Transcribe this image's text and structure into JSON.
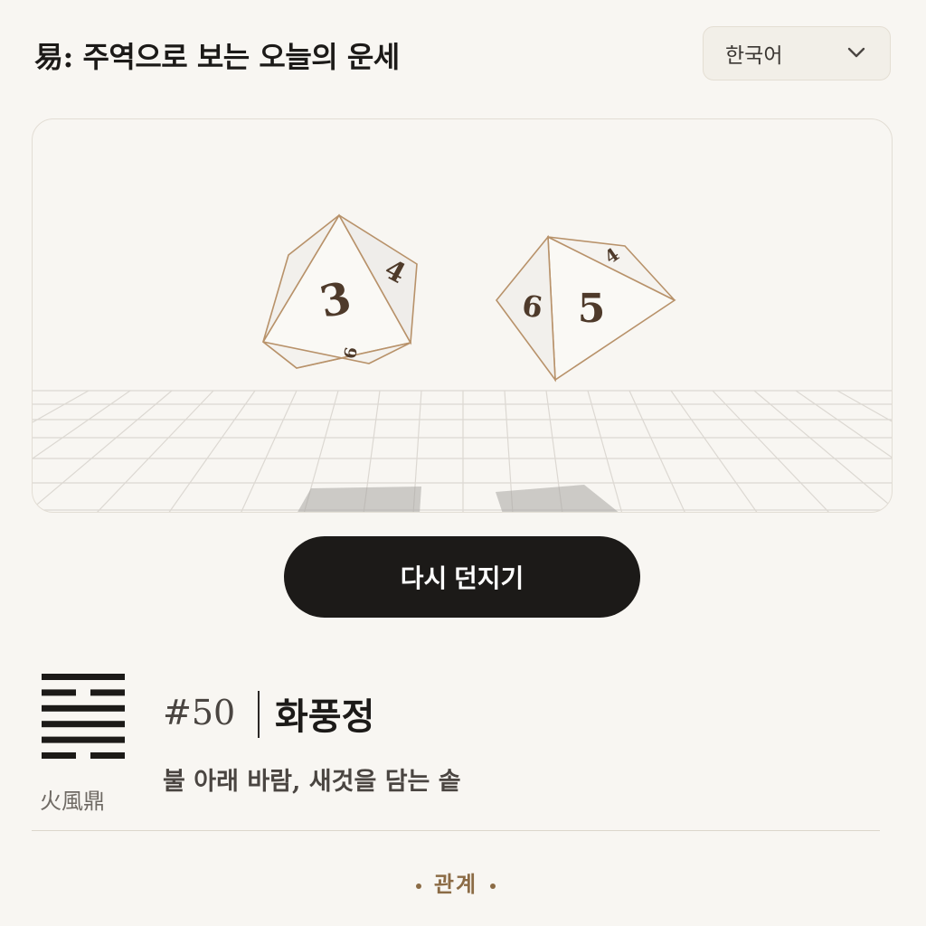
{
  "header": {
    "title": "易: 주역으로 보는 오늘의 운세",
    "language": {
      "selected": "한국어"
    }
  },
  "stage": {
    "dice": [
      {
        "front_number": "3",
        "side_number": "4",
        "bottom_number": "6"
      },
      {
        "front_number": "5",
        "side_number": "6",
        "top_number": "4"
      }
    ]
  },
  "actions": {
    "reroll_label": "다시 던지기"
  },
  "hexagram": {
    "chinese": "火風鼎",
    "number": "#50",
    "name": "화풍정",
    "description": "불 아래 바람, 새것을 담는 솥",
    "lines": [
      "solid",
      "broken",
      "solid",
      "solid",
      "solid",
      "broken"
    ]
  },
  "section": {
    "title": "관계"
  },
  "colors": {
    "ink": "#1c1a18",
    "accent": "#8b6b45",
    "background": "#f8f6f2"
  }
}
